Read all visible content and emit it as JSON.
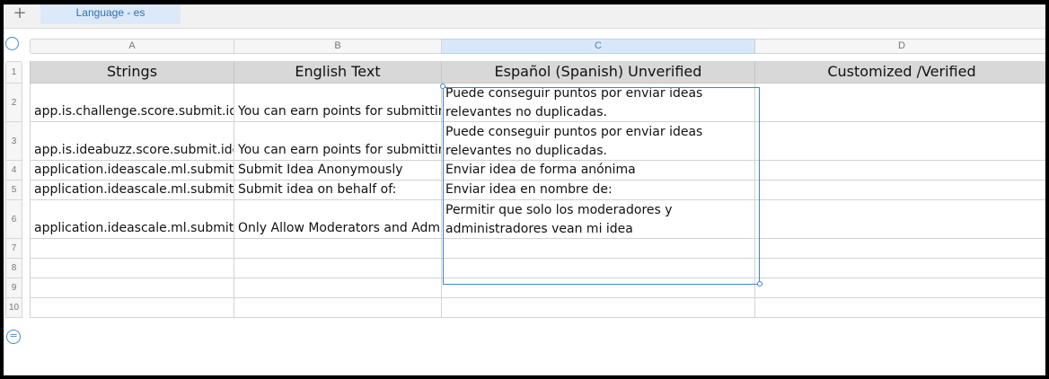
{
  "tabbar": {
    "add_label": "+",
    "sheet_tab": "Language - es"
  },
  "columns": [
    "A",
    "B",
    "C",
    "D"
  ],
  "rows": [
    "1",
    "2",
    "3",
    "4",
    "5",
    "6",
    "7",
    "8",
    "9",
    "10"
  ],
  "table": {
    "headers": [
      "Strings",
      "English Text",
      "Español (Spanish) Unverified",
      "Customized /Verified"
    ],
    "rows": [
      [
        "app.is.challenge.score.submit.idea",
        "You can earn points for submitting relevant non-duplicate ideas.",
        "Puede conseguir puntos por enviar ideas relevantes no duplicadas.",
        ""
      ],
      [
        "app.is.ideabuzz.score.submit.idea",
        "You can earn points for submitting relevant non-duplicate ideas.",
        "Puede conseguir puntos por enviar ideas relevantes no duplicadas.",
        ""
      ],
      [
        "application.ideascale.ml.submit.anonymous",
        "Submit Idea Anonymously",
        "Enviar idea de forma anónima",
        ""
      ],
      [
        "application.ideascale.ml.submit.onbehalf",
        "Submit idea on behalf of:",
        "Enviar idea en nombre de:",
        ""
      ],
      [
        "application.ideascale.ml.submit.moderators",
        "Only Allow Moderators and Administrators to see my idea",
        "Permitir que solo los moderadores y administradores vean mi idea",
        ""
      ],
      [
        "",
        "",
        "",
        ""
      ],
      [
        "",
        "",
        "",
        ""
      ],
      [
        "",
        "",
        "",
        ""
      ],
      [
        "",
        "",
        "",
        ""
      ]
    ]
  },
  "selection": {
    "column": "C",
    "from_row": "2",
    "to_row": "10"
  },
  "colors": {
    "accent": "#3e86cf",
    "header_fill": "#d8d8d8",
    "tab_fill": "#dce9f8"
  }
}
